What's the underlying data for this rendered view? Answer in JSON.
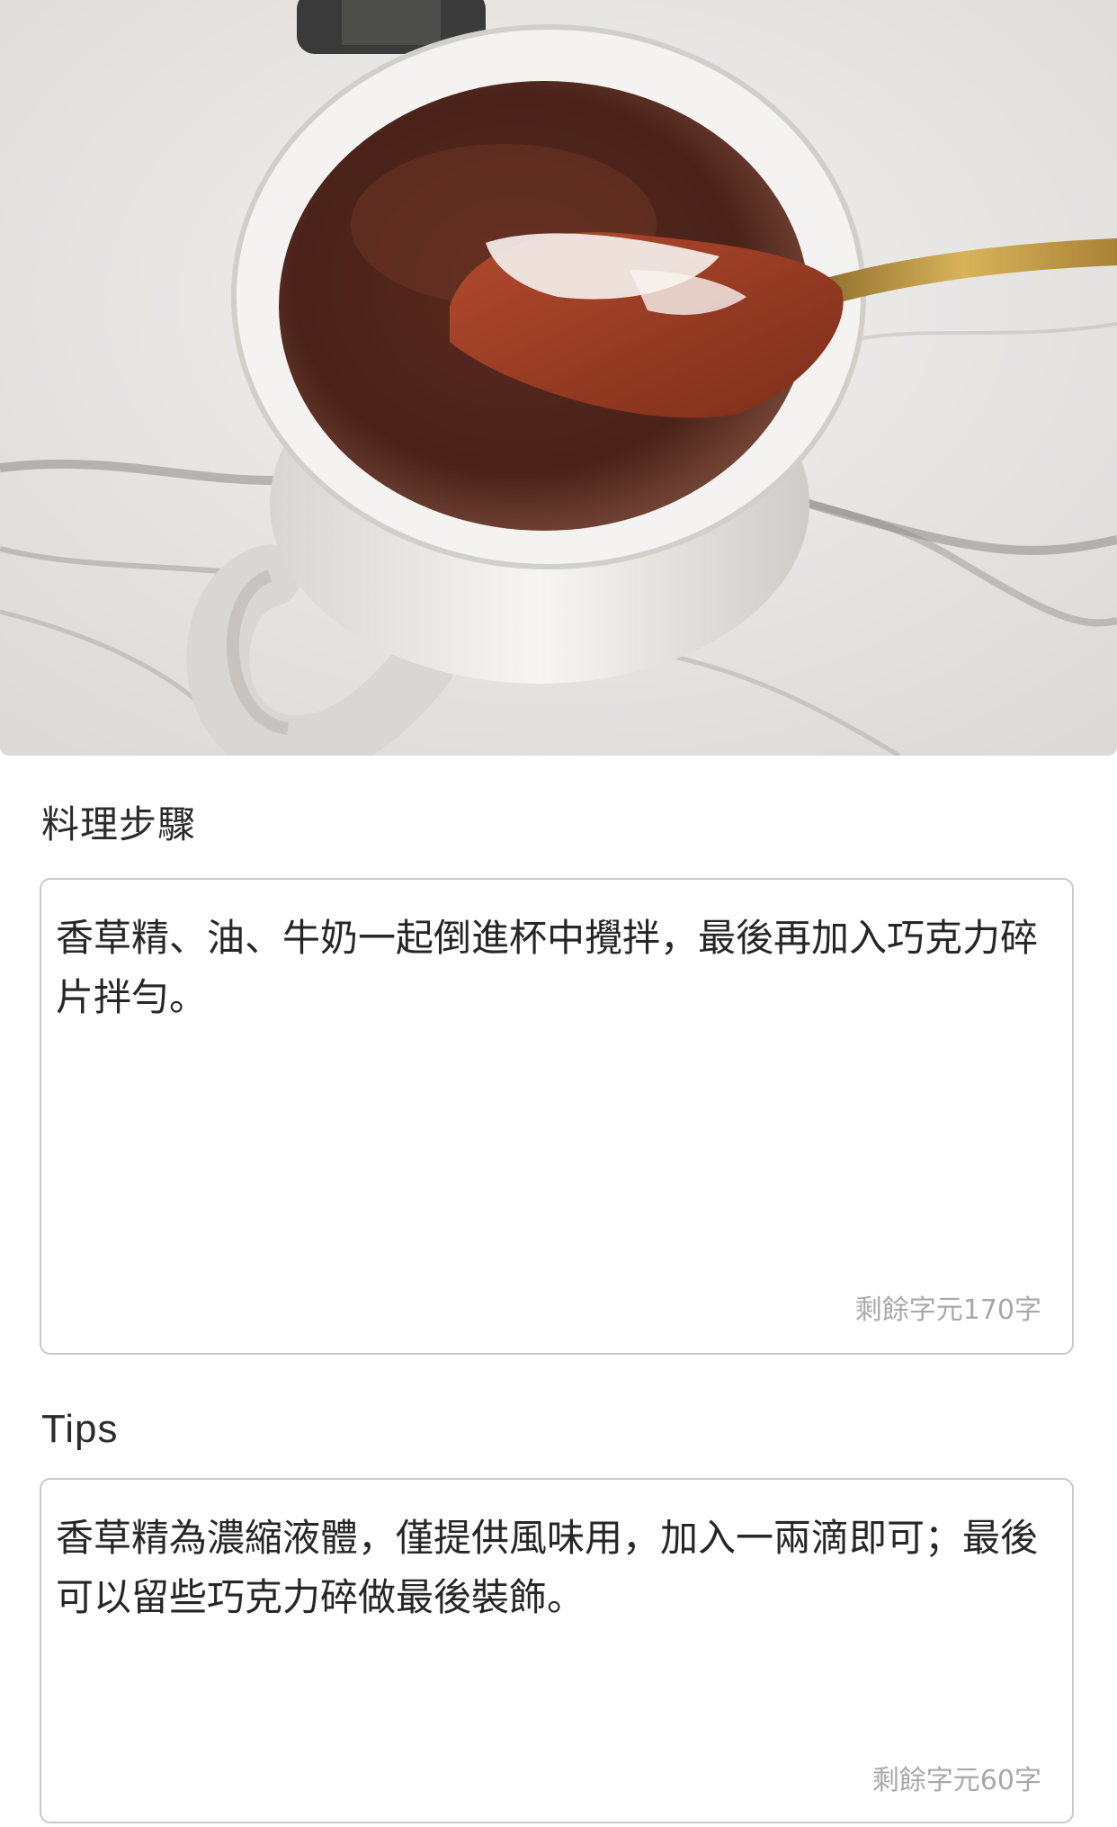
{
  "hero_image": {
    "subject": "chocolate-mug-cake-photo"
  },
  "steps": {
    "label": "料理步驟",
    "text": "香草精、油、牛奶一起倒進杯中攪拌，最後再加入巧克力碎片拌勻。",
    "counter": "剩餘字元170字"
  },
  "tips": {
    "label": "Tips",
    "text": "香草精為濃縮液體，僅提供風味用，加入一兩滴即可；最後可以留些巧克力碎做最後裝飾。",
    "counter": "剩餘字元60字"
  },
  "colors": {
    "border": "#c9c9c9",
    "counter_text": "#a8a8a8",
    "body_text": "#262626"
  }
}
